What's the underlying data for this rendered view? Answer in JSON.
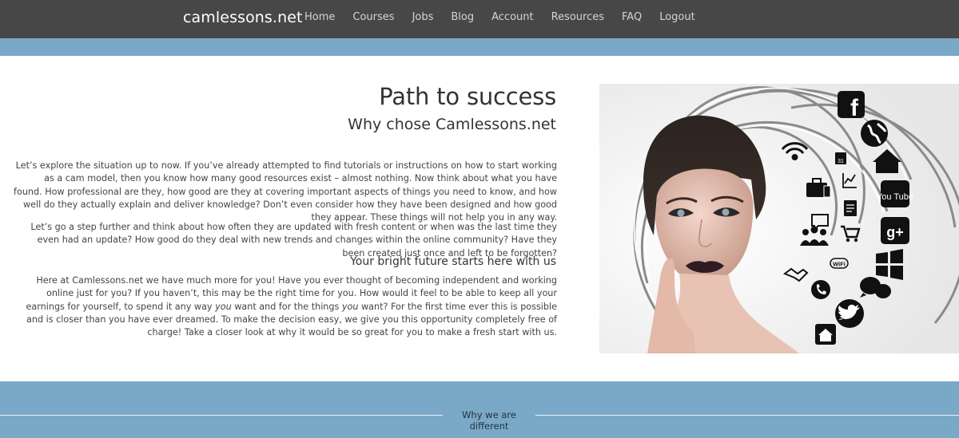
{
  "header": {
    "brand": "camlessons.net",
    "nav": [
      "Home",
      "Courses",
      "Jobs",
      "Blog",
      "Account",
      "Resources",
      "FAQ",
      "Logout"
    ]
  },
  "main": {
    "title": "Path to success",
    "subtitle": "Why chose Camlessons.net",
    "paragraph1": "Let’s explore the situation up to now. If you’ve already attempted to find  tutorials or instructions on how to start working as a cam model, then you know how many good resources exist – almost nothing. Now think about what you have found. How professional are they, how good are they at covering important aspects of things you need to know, and how well do they actually explain and deliver knowledge? Don’t even consider how they have been designed and how good they appear. These things will not help you in any way.",
    "paragraph2": "Let’s go a step further and think about how often they are updated with fresh content or when was the last time they even had an update? How good do they deal with new trends and changes within the online community? Have they been created just once and left to be forgotten?",
    "heading2": "Your bright future starts here with us",
    "paragraph3": {
      "part1": "Here at Camlessons.net we have much more for you! Have you ever thought of becoming independent and working online just for you? If you haven’t, this may be the right time for you. How would it feel to be able to keep all your earnings for yourself, to spend it any way ",
      "em1": "you",
      "part2": " want and for the things ",
      "em2": "you",
      "part3": " want? For the first time ever this is possible and is closer than you have ever dreamed. To make the decision easy, we give you this opportunity completely free of charge! Take a closer look at why it would be so great for you to make a fresh start with us."
    }
  },
  "image": {
    "icons": [
      "facebook-icon",
      "globe-icon",
      "wifi-icon",
      "calendar-icon",
      "home-icon",
      "briefcase-icon",
      "chart-icon",
      "youtube-icon",
      "document-icon",
      "chat-icon",
      "cart-icon",
      "people-icon",
      "google-plus-icon",
      "windows-icon",
      "handshake-icon",
      "wifi-badge-icon",
      "phone-icon",
      "speech-bubbles-icon",
      "twitter-icon",
      "house-icon"
    ],
    "youtube_text": "You Tube",
    "facebook_letter": "f",
    "gplus_text": "g+",
    "calendar_day": "31",
    "wifi_badge": "WiFi"
  },
  "footer_band": {
    "divider_label": "Why we are different"
  }
}
